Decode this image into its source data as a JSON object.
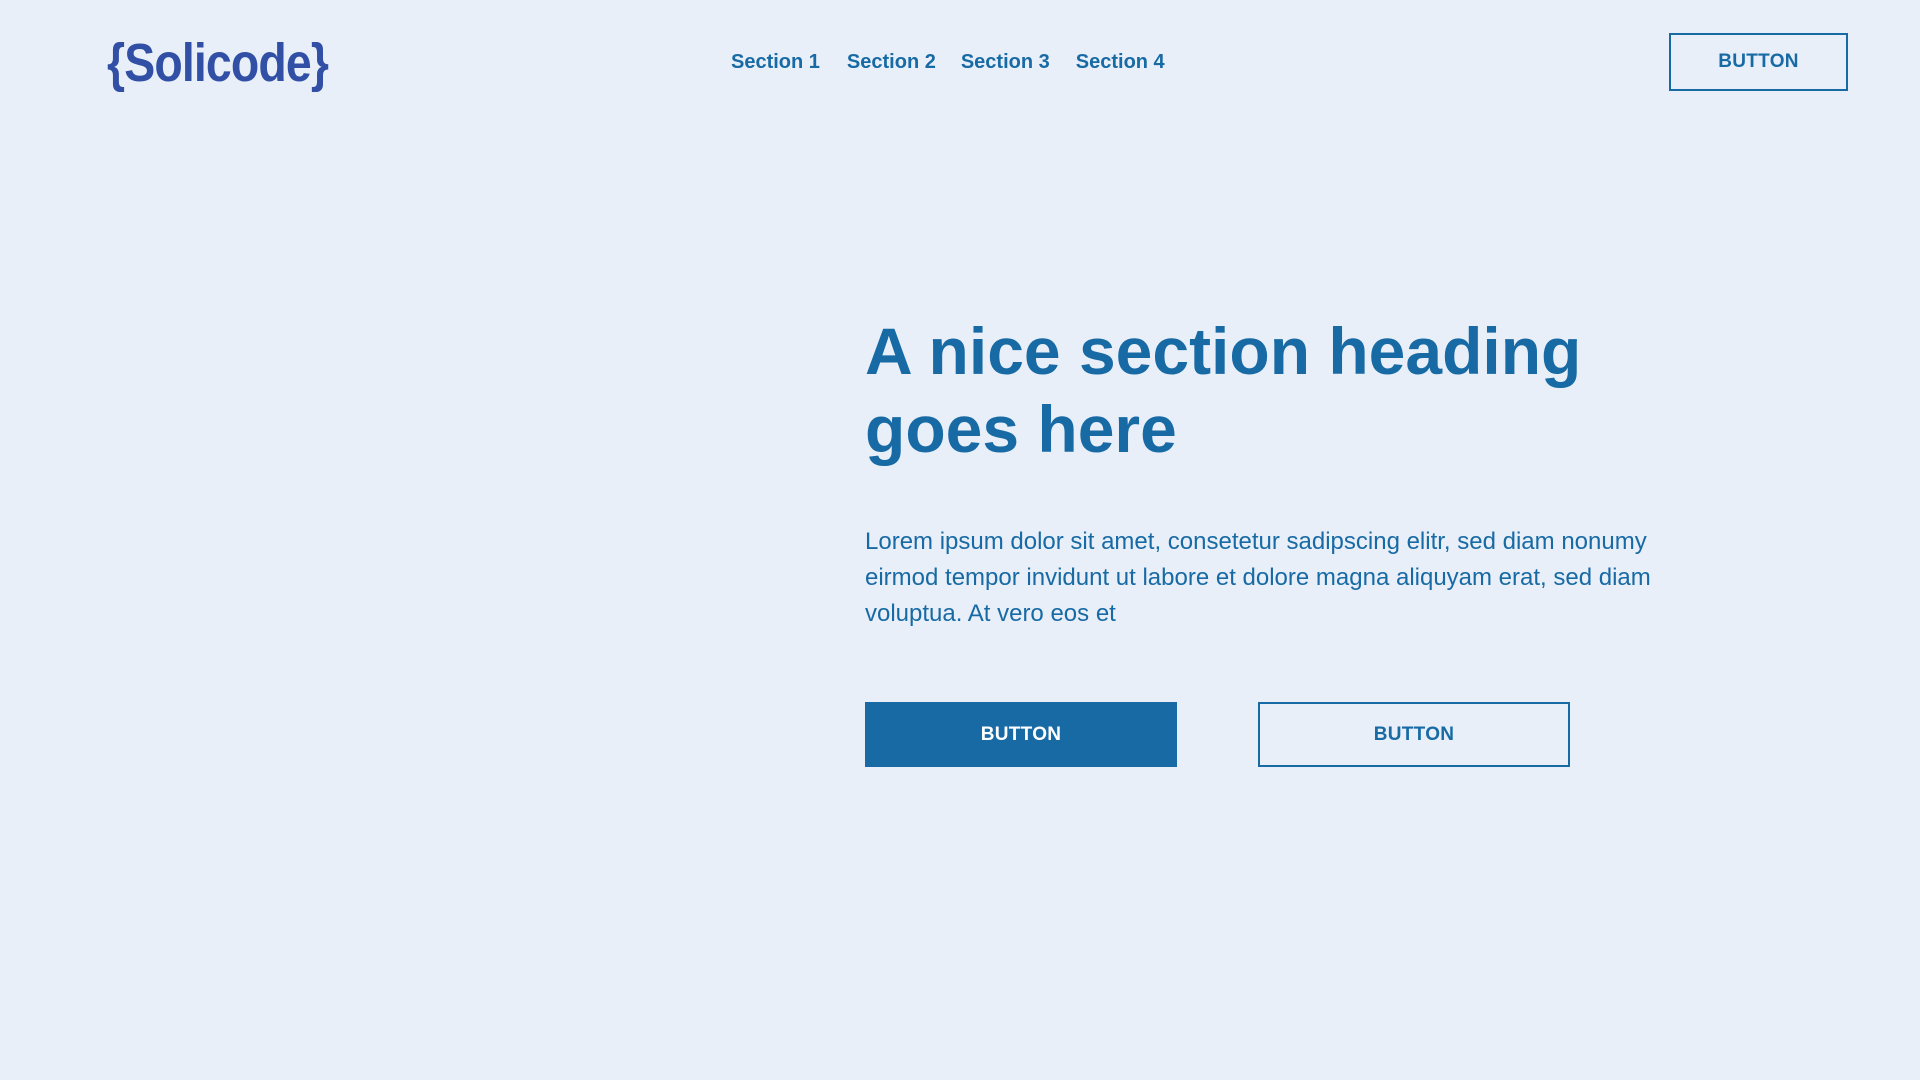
{
  "header": {
    "logo_text": "{Solicode}",
    "nav": [
      {
        "label": "Section 1"
      },
      {
        "label": "Section 2"
      },
      {
        "label": "Section 3"
      },
      {
        "label": "Section 4"
      }
    ],
    "cta_label": "BUTTON"
  },
  "hero": {
    "heading": "A nice section heading goes here",
    "body": "Lorem ipsum dolor sit amet, consetetur sadipscing elitr, sed diam nonumy eirmod tempor invidunt ut labore et dolore magna aliquyam erat, sed diam voluptua. At vero eos et",
    "primary_button": "BUTTON",
    "secondary_button": "BUTTON"
  },
  "colors": {
    "background": "#e8eff8",
    "accent": "#186aa5",
    "logo": "#3150a5"
  }
}
